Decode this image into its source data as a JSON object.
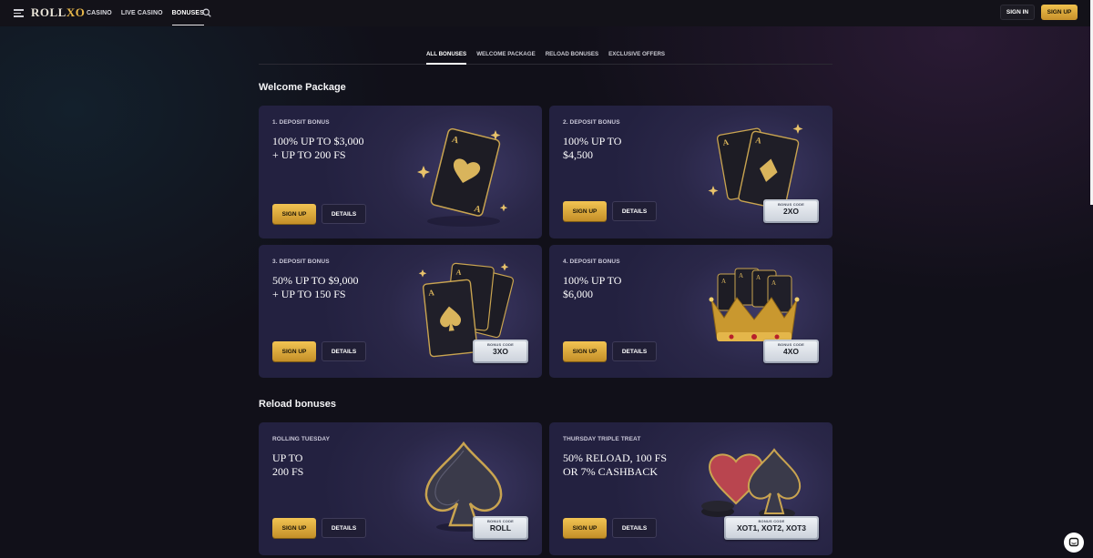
{
  "header": {
    "logo_text_a": "ROLL",
    "logo_text_x": "X",
    "logo_text_b": "O",
    "nav": [
      {
        "label": "CASINO"
      },
      {
        "label": "LIVE CASINO"
      },
      {
        "label": "BONUSES"
      }
    ],
    "active_nav": "BONUSES",
    "signin_label": "SIGN IN",
    "signup_label": "SIGN UP"
  },
  "tabs": [
    {
      "label": "ALL BONUSES"
    },
    {
      "label": "WELCOME PACKAGE"
    },
    {
      "label": "RELOAD BONUSES"
    },
    {
      "label": "EXCLUSIVE OFFERS"
    }
  ],
  "sections": {
    "welcome_title": "Welcome Package",
    "reload_title": "Reload bonuses"
  },
  "cards": [
    {
      "eyebrow": "1. DEPOSIT BONUS",
      "headline": "100% UP TO $3,000\n+ UP TO 200 FS",
      "signup": "SIGN UP",
      "details": "DETAILS",
      "code_label": "",
      "code": ""
    },
    {
      "eyebrow": "2. DEPOSIT BONUS",
      "headline": "100% UP TO\n$4,500",
      "signup": "SIGN UP",
      "details": "DETAILS",
      "code_label": "BONUS CODE",
      "code": "2XO"
    },
    {
      "eyebrow": "3. DEPOSIT BONUS",
      "headline": "50% UP TO $9,000\n+ UP TO 150 FS",
      "signup": "SIGN UP",
      "details": "DETAILS",
      "code_label": "BONUS CODE",
      "code": "3XO"
    },
    {
      "eyebrow": "4. DEPOSIT BONUS",
      "headline": "100% UP TO\n$6,000",
      "signup": "SIGN UP",
      "details": "DETAILS",
      "code_label": "BONUS CODE",
      "code": "4XO"
    },
    {
      "eyebrow": "ROLLING TUESDAY",
      "headline": "UP TO\n200 FS",
      "signup": "SIGN UP",
      "details": "DETAILS",
      "code_label": "BONUS CODE",
      "code": "ROLL"
    },
    {
      "eyebrow": "THURSDAY TRIPLE TREAT",
      "headline": "50% RELOAD, 100 FS\nOR 7% CASHBACK",
      "signup": "SIGN UP",
      "details": "DETAILS",
      "code_label": "BONUS CODE",
      "code": "XOT1, XOT2, XOT3"
    }
  ],
  "icons": {
    "menu": "hamburger-icon",
    "search": "search-icon",
    "chat": "chat-icon"
  },
  "colors": {
    "accent_gold": "#e9b84a",
    "background": "#111019",
    "card": "#2a2748"
  }
}
